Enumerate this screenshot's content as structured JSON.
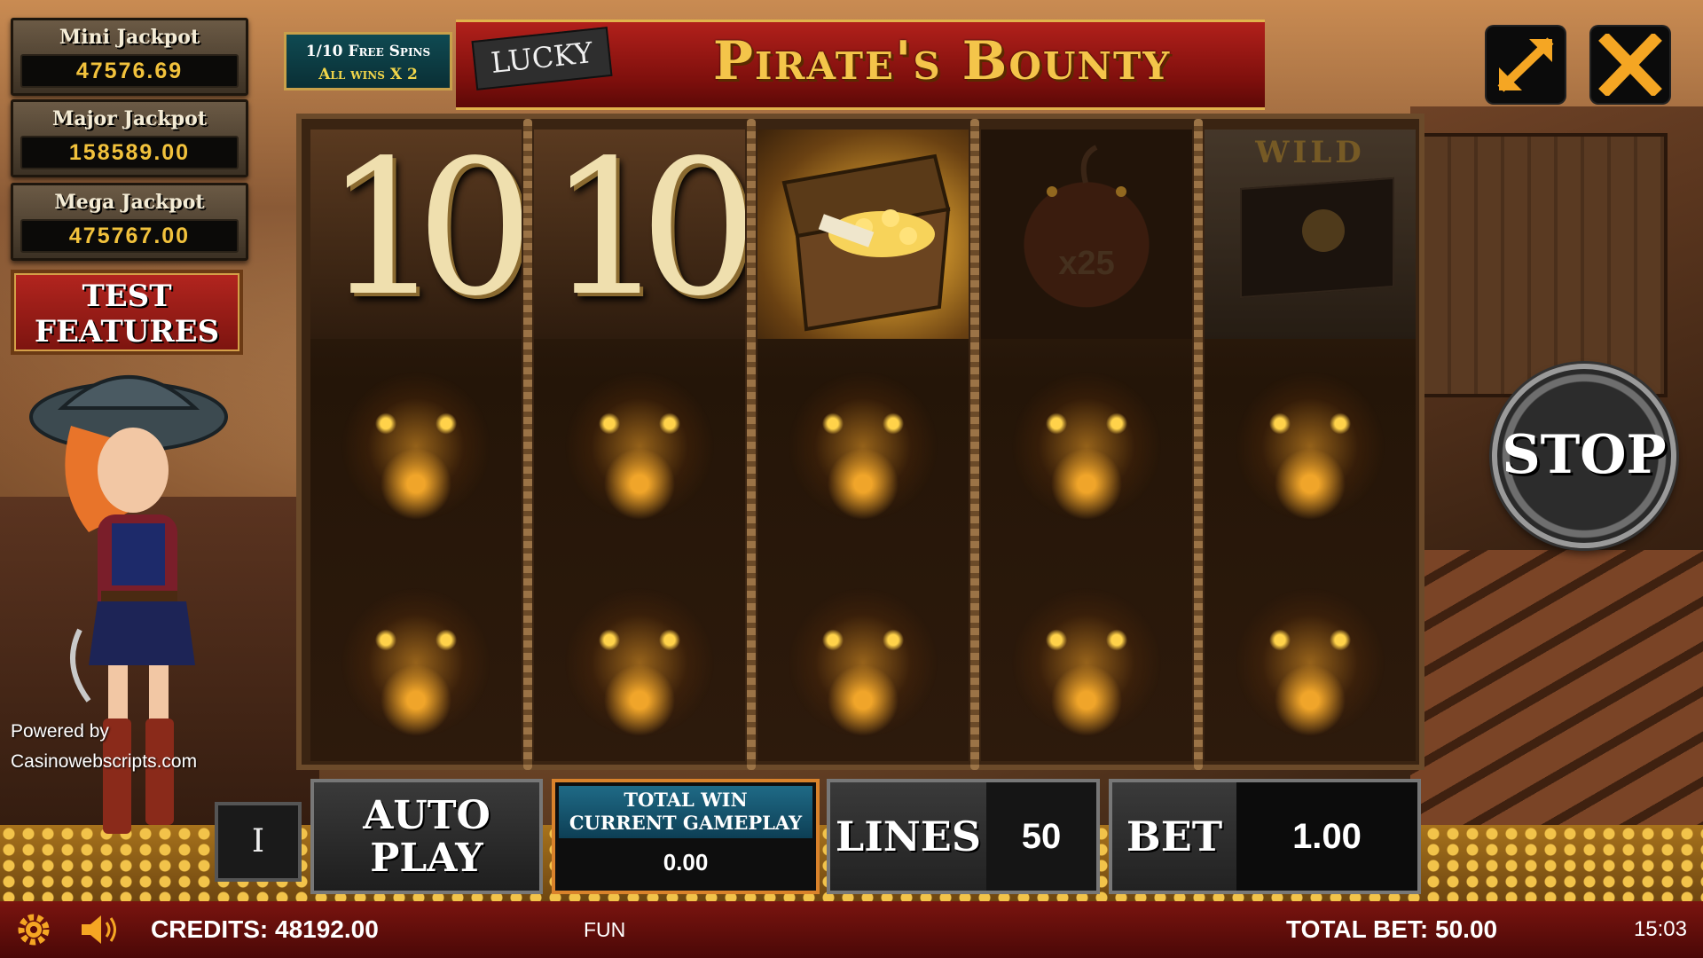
{
  "jackpots": [
    {
      "label": "Mini Jackpot",
      "value": "47576.69"
    },
    {
      "label": "Major Jackpot",
      "value": "158589.00"
    },
    {
      "label": "Mega Jackpot",
      "value": "475767.00"
    }
  ],
  "test_features_label": "TEST FEATURES",
  "free_spins": {
    "line1": "1/10 Free Spins",
    "line2": "All wins X 2"
  },
  "title": {
    "lucky": "LUCKY",
    "main": "Pirate's Bounty"
  },
  "watermark": {
    "line1": "Powered by",
    "line2": "Casinowebscripts.com"
  },
  "reels": [
    {
      "top": {
        "symbol": "ten",
        "text": "10"
      }
    },
    {
      "top": {
        "symbol": "ten",
        "text": "10"
      }
    },
    {
      "top": {
        "symbol": "chest"
      }
    },
    {
      "top": {
        "symbol": "bomb",
        "text": "x25"
      }
    },
    {
      "top": {
        "symbol": "wild",
        "text": "WILD"
      }
    }
  ],
  "stop_label": "STOP",
  "controls": {
    "counter": "I",
    "autoplay_line1": "AUTO",
    "autoplay_line2": "PLAY",
    "total_win_line1": "TOTAL WIN",
    "total_win_line2": "CURRENT GAMEPLAY",
    "total_win_value": "0.00",
    "lines_label": "LINES",
    "lines_value": "50",
    "bet_label": "BET",
    "bet_value": "1.00"
  },
  "status": {
    "credits_label": "CREDITS:",
    "credits_value": "48192.00",
    "mode": "FUN",
    "total_bet_label": "TOTAL BET:",
    "total_bet_value": "50.00",
    "time": "15:03"
  },
  "icons": {
    "settings": "gear-icon",
    "sound": "speaker-icon",
    "fullscreen": "expand-icon",
    "close": "close-icon"
  },
  "colors": {
    "gold": "#f4c54a",
    "banner_red": "#b1201b",
    "status_red": "#7a140f",
    "total_win_border": "#d9822b",
    "total_win_header": "#1f6a86"
  }
}
